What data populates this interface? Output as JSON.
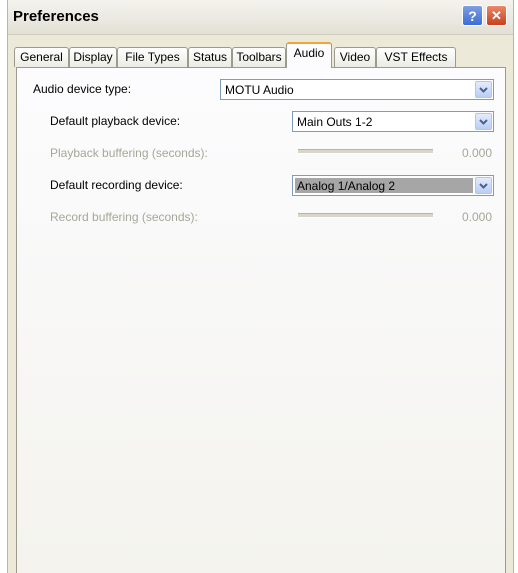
{
  "window": {
    "title": "Preferences",
    "help_glyph": "?",
    "close_glyph": "✕"
  },
  "tabs": [
    {
      "label": "General"
    },
    {
      "label": "Display"
    },
    {
      "label": "File Types"
    },
    {
      "label": "Status"
    },
    {
      "label": "Toolbars"
    },
    {
      "label": "Audio"
    },
    {
      "label": "Video"
    },
    {
      "label": "VST Effects"
    }
  ],
  "active_tab": "Audio",
  "audio": {
    "device_type_label": "Audio device type:",
    "device_type_value": "MOTU Audio",
    "playback_device_label": "Default playback device:",
    "playback_device_value": "Main Outs 1-2",
    "playback_buffer_label": "Playback buffering (seconds):",
    "playback_buffer_value": "0.000",
    "recording_device_label": "Default recording device:",
    "recording_device_value": "Analog 1/Analog 2",
    "record_buffer_label": "Record buffering (seconds):",
    "record_buffer_value": "0.000"
  },
  "colors": {
    "active_tab_accent": "#f1a33a",
    "combo_border": "#7f9db9",
    "disabled_text": "#a7a698"
  }
}
